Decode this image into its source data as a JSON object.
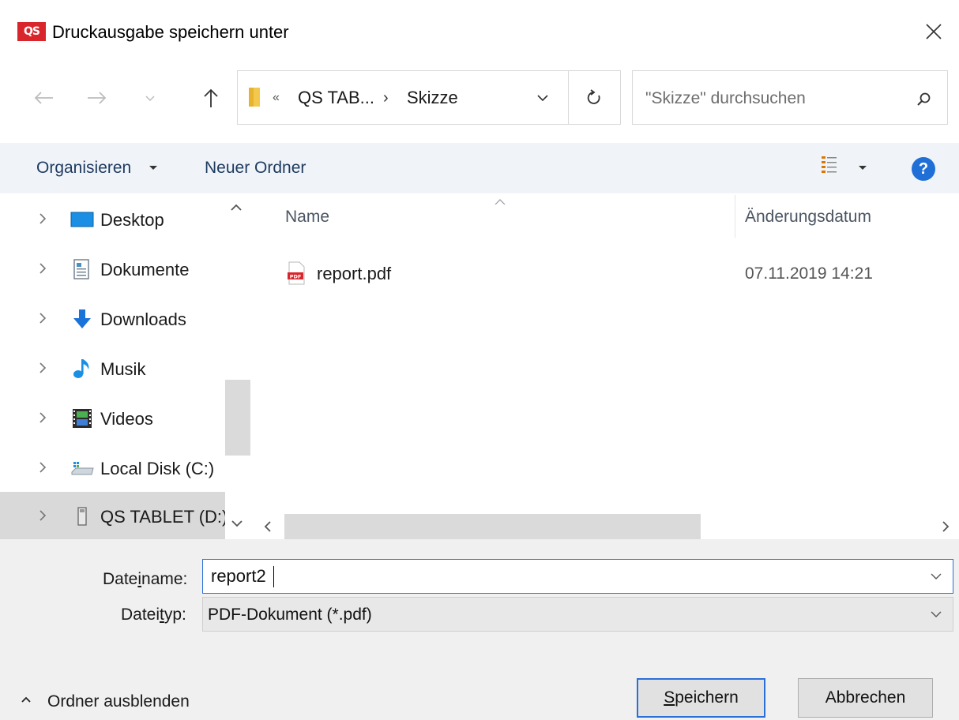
{
  "window": {
    "app_logo_text": "QS",
    "title": "Druckausgabe speichern unter",
    "close_icon": "close-icon"
  },
  "nav": {
    "back_icon": "arrow-left-icon",
    "forward_icon": "arrow-right-icon",
    "recent_icon": "chevron-down-icon",
    "up_icon": "arrow-up-icon"
  },
  "address": {
    "overflow_chevrons": "«",
    "segments": [
      "QS TAB...",
      "Skizze"
    ],
    "separator": "›",
    "refresh_icon": "refresh-icon"
  },
  "search": {
    "placeholder": "\"Skizze\" durchsuchen"
  },
  "toolbar": {
    "organize_label": "Organisieren",
    "new_folder_label": "Neuer Ordner",
    "help_label": "?"
  },
  "sidebar": {
    "items": [
      {
        "label": "Desktop",
        "icon": "desktop-icon"
      },
      {
        "label": "Dokumente",
        "icon": "documents-icon"
      },
      {
        "label": "Downloads",
        "icon": "downloads-icon"
      },
      {
        "label": "Musik",
        "icon": "music-icon"
      },
      {
        "label": "Videos",
        "icon": "videos-icon"
      },
      {
        "label": "Local Disk (C:)",
        "icon": "local-disk-icon"
      },
      {
        "label": "QS TABLET (D:)",
        "icon": "usb-drive-icon",
        "selected": true
      }
    ]
  },
  "filelist": {
    "columns": {
      "name": "Name",
      "date": "Änderungsdatum"
    },
    "files": [
      {
        "name": "report.pdf",
        "date": "07.11.2019 14:21",
        "icon": "pdf-file-icon"
      }
    ]
  },
  "form": {
    "filename_label_pre": "Date",
    "filename_label_ul": "i",
    "filename_label_post": "name:",
    "filename_value": "report2",
    "filetype_label_pre": "Datei",
    "filetype_label_ul": "t",
    "filetype_label_post": "yp:",
    "filetype_value": "PDF-Dokument (*.pdf)"
  },
  "footer": {
    "hide_folders_label": "Ordner ausblenden",
    "save_label_ul": "S",
    "save_label_rest": "peichern",
    "cancel_label": "Abbrechen"
  },
  "colors": {
    "accent": "#2a6fd6",
    "logo": "#d9262c",
    "command_bar": "#f0f4f9"
  }
}
